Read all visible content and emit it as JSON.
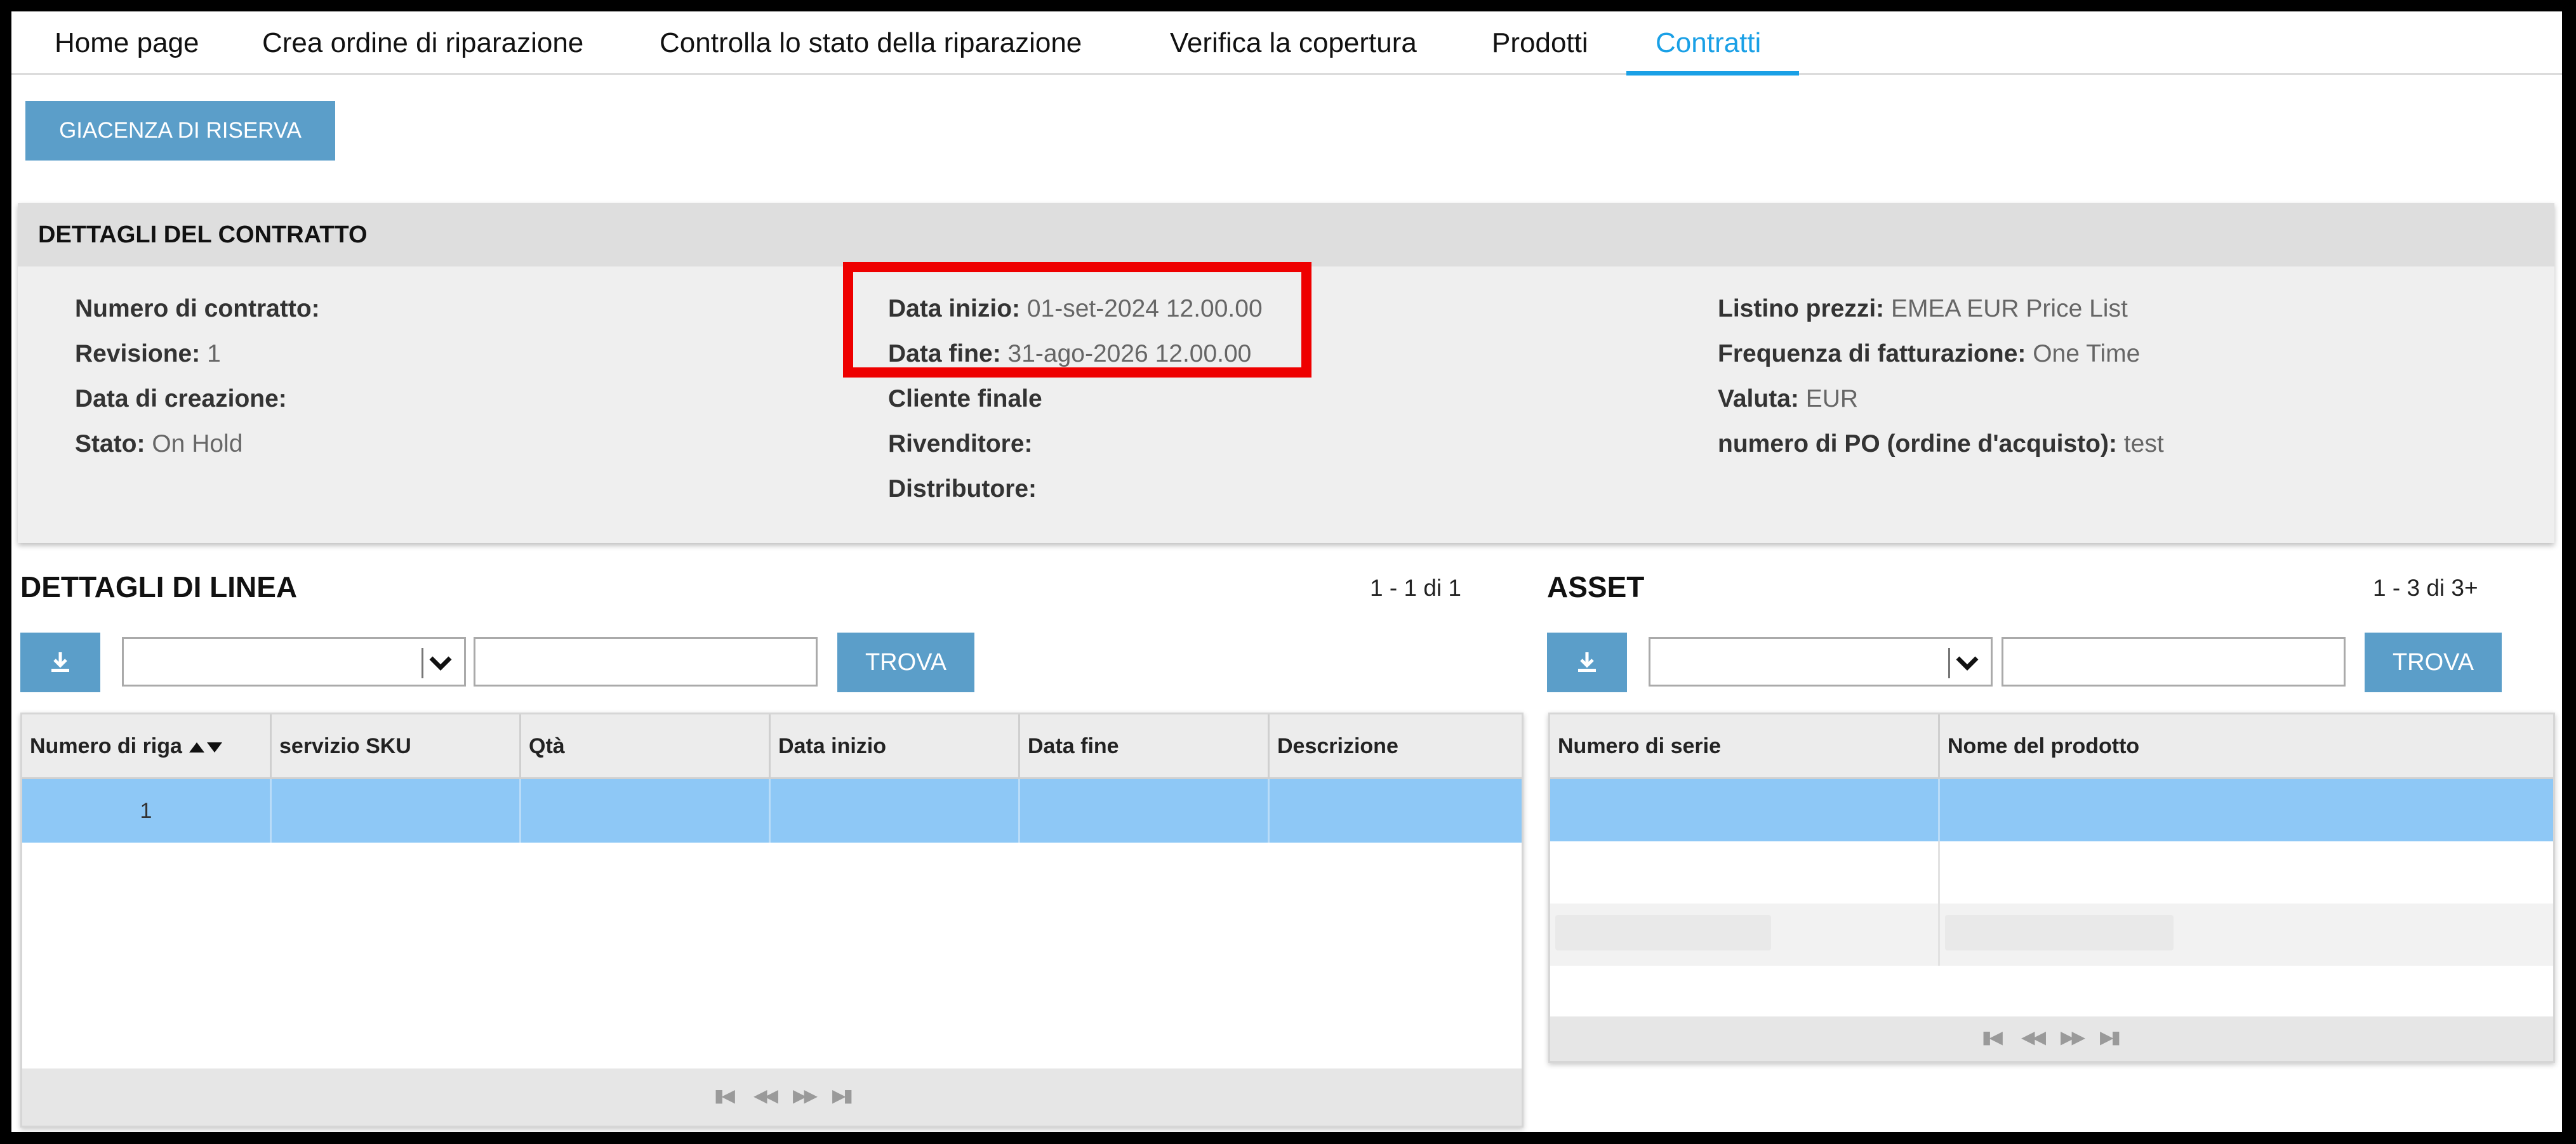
{
  "nav": {
    "tabs": [
      {
        "label": "Home page"
      },
      {
        "label": "Crea ordine di riparazione"
      },
      {
        "label": "Controlla lo stato della riparazione"
      },
      {
        "label": "Verifica la copertura"
      },
      {
        "label": "Prodotti"
      },
      {
        "label": "Contratti"
      }
    ],
    "active_color": "#1aa0e6"
  },
  "reserve_button": "GIACENZA DI RISERVA",
  "contract": {
    "title": "DETTAGLI DEL CONTRATTO",
    "col1": {
      "contract_number": {
        "label": "Numero di contratto:",
        "value": ""
      },
      "revision": {
        "label": "Revisione:",
        "value": "1"
      },
      "creation_date": {
        "label": "Data di creazione:",
        "value": ""
      },
      "status": {
        "label": "Stato:",
        "value": "On Hold"
      }
    },
    "col2": {
      "start_date": {
        "label": "Data inizio:",
        "value": "01-set-2024 12.00.00"
      },
      "end_date": {
        "label": "Data fine:",
        "value": "31-ago-2026 12.00.00"
      },
      "end_customer": {
        "label": "Cliente finale",
        "value": ""
      },
      "reseller": {
        "label": "Rivenditore:",
        "value": ""
      },
      "distributor": {
        "label": "Distributore:",
        "value": ""
      }
    },
    "col3": {
      "price_list": {
        "label": "Listino prezzi:",
        "value": "EMEA EUR Price List"
      },
      "billing_frequency": {
        "label": "Frequenza di fatturazione:",
        "value": "One Time"
      },
      "currency": {
        "label": "Valuta:",
        "value": "EUR"
      },
      "po_number": {
        "label": "numero di PO (ordine d'acquisto):",
        "value": "test"
      }
    },
    "highlight_color": "#ee0000"
  },
  "line_details": {
    "title": "DETTAGLI DI LINEA",
    "count": "1 - 1 di 1",
    "find_label": "TROVA",
    "columns": [
      "Numero di riga",
      "servizio SKU",
      "Qtà",
      "Data inizio",
      "Data fine",
      "Descrizione"
    ],
    "rows": [
      {
        "line": "1",
        "sku": "",
        "qty": "",
        "start": "",
        "end": "",
        "desc": ""
      }
    ]
  },
  "assets": {
    "title": "ASSET",
    "count": "1 - 3 di 3+",
    "find_label": "TROVA",
    "columns": [
      "Numero di serie",
      "Nome del prodotto"
    ]
  },
  "icons": {
    "download": "download-icon",
    "chevron": "chevron-down-icon",
    "sort": "sort-icon",
    "pager": [
      "first-page-icon",
      "prev-page-icon",
      "next-page-icon",
      "last-page-icon"
    ]
  },
  "colors": {
    "button": "#5b9ec9",
    "selected_row": "#8ec8f6"
  }
}
